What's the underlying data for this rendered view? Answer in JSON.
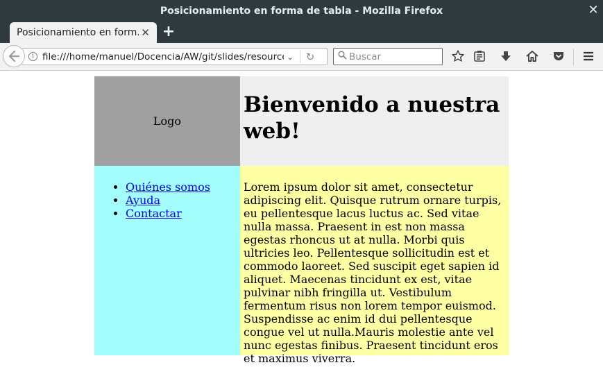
{
  "window": {
    "title": "Posicionamiento en forma de tabla - Mozilla Firefox",
    "close_glyph": "✕"
  },
  "tabs": [
    {
      "label": "Posicionamiento en form...",
      "close_glyph": "✕"
    }
  ],
  "newtab_glyph": "+",
  "navbar": {
    "url": "file:///home/manuel/Docencia/AW/git/slides/resources",
    "search_placeholder": "Buscar",
    "icons": [
      "back-icon",
      "info-icon",
      "dropdown-icon",
      "reload-icon",
      "search-icon",
      "bookmark-star-icon",
      "reading-list-icon",
      "download-icon",
      "home-icon",
      "pocket-icon",
      "menu-icon"
    ]
  },
  "page": {
    "logo": "Logo",
    "heading": "Bienvenido a nuestra web!",
    "nav_links": [
      "Quiénes somos",
      "Ayuda",
      "Contactar"
    ],
    "body_text": "Lorem ipsum dolor sit amet, consectetur adipiscing elit. Quisque rutrum ornare turpis, eu pellentesque lacus luctus ac. Sed vitae nulla massa. Praesent in est non massa egestas rhoncus ut at nulla. Morbi quis ultricies leo. Pellentesque sollicitudin est et commodo laoreet. Sed suscipit eget sapien id aliquet. Maecenas tincidunt ex est, vitae pulvinar nibh fringilla ut. Vestibulum fermentum risus non lorem tempor euismod. Suspendisse ac enim id dui pellentesque congue vel ut nulla.Mauris molestie ante vel nunc egestas finibus. Praesent tincidunt eros et maximus viverra."
  },
  "colors": {
    "titlebar": "#2f3a3f",
    "logo_cell": "#a0a0a0",
    "header_cell": "#efefef",
    "nav_cell": "#a3fdfd",
    "content_cell": "#ffffa4",
    "link": "#0000ee"
  }
}
